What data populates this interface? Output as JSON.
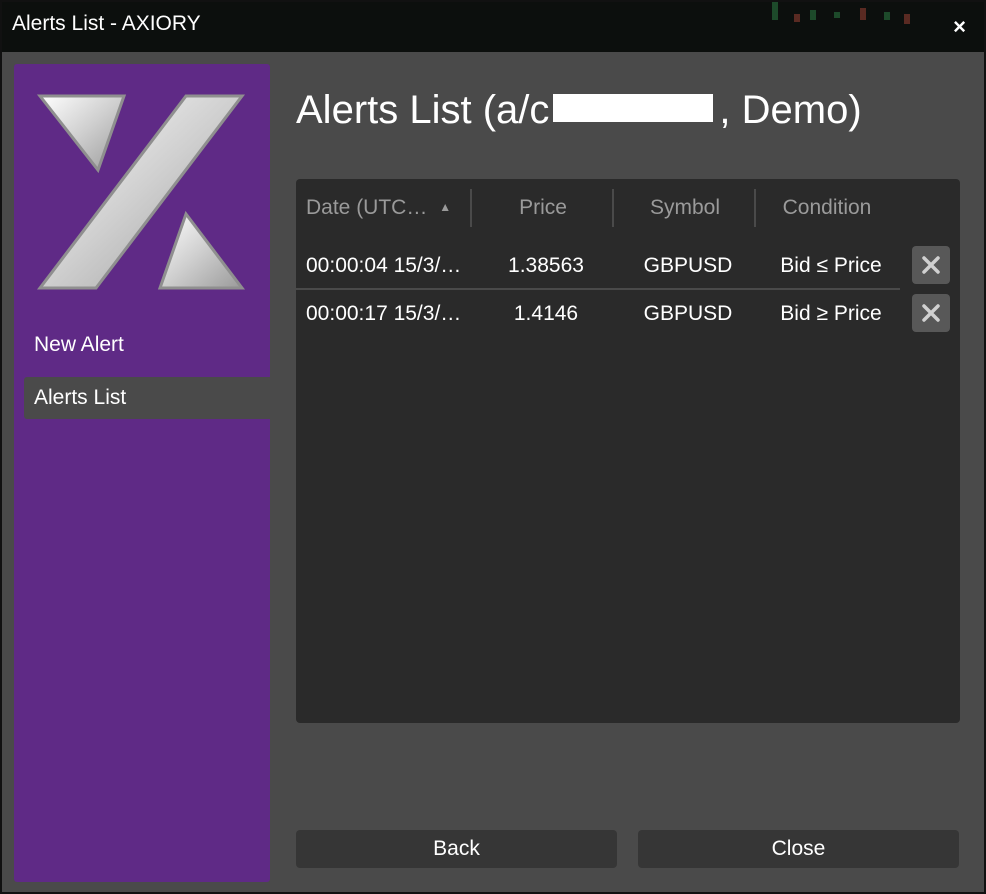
{
  "window": {
    "title": "Alerts List - AXIORY",
    "close_glyph": "×"
  },
  "sidebar": {
    "logo": "axiory-logo",
    "items": [
      {
        "label": "New Alert",
        "active": false
      },
      {
        "label": "Alerts List",
        "active": true
      }
    ]
  },
  "main": {
    "title_prefix": "Alerts List (a/c",
    "title_suffix": ", Demo)"
  },
  "table": {
    "columns": [
      "Date  (UTC…",
      "Price",
      "Symbol",
      "Condition"
    ],
    "sort_indicator": "▲",
    "rows": [
      {
        "date": "00:00:04 15/3/…",
        "price": "1.38563",
        "symbol": "GBPUSD",
        "condition": "Bid ≤ Price"
      },
      {
        "date": "00:00:17 15/3/…",
        "price": "1.4146",
        "symbol": "GBPUSD",
        "condition": "Bid ≥ Price"
      }
    ]
  },
  "footer": {
    "back_label": "Back",
    "close_label": "Close"
  },
  "colors": {
    "sidebar": "#5f2a86",
    "panel": "#4a4a4a",
    "table": "#2a2a2a"
  }
}
